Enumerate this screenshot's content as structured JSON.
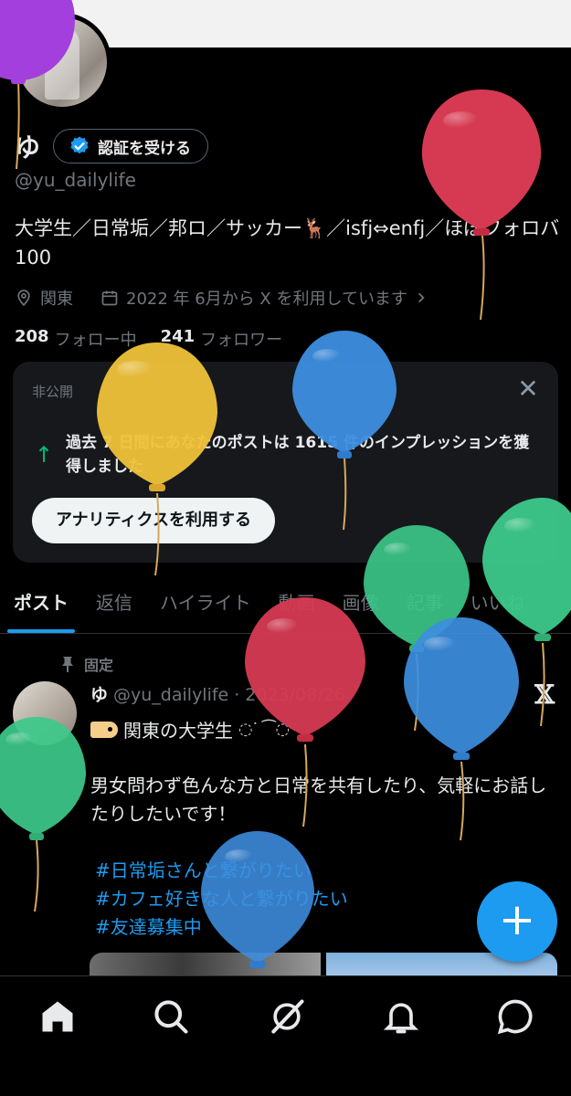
{
  "profile": {
    "name": "ゆ",
    "verify_label": "認証を受ける",
    "handle": "@yu_dailylife",
    "bio": "大学生／日常垢／邦ロ／サッカー🦌／isfj⇔enfj／ほぼフォロバ100",
    "location": "関東",
    "joined": "2022 年 6月から X を利用しています",
    "following_count": "208",
    "following_label": "フォロー中",
    "followers_count": "241",
    "followers_label": "フォロワー"
  },
  "analytics_card": {
    "private_label": "非公開",
    "message": "過去 7 日間にあなたのポストは 1615 件のインプレッションを獲得しました",
    "button_label": "アナリティクスを利用する"
  },
  "tabs": [
    "ポスト",
    "返信",
    "ハイライト",
    "動画",
    "画像",
    "記事",
    "いいね"
  ],
  "pinned_post": {
    "pinned_label": "固定",
    "author_name": "ゆ",
    "author_handle": "@yu_dailylife",
    "date": "2023/08/26",
    "line1": "関東の大学生",
    "body": "男女問わず色んな方と日常を共有したり、気軽にお話したりしたいです！",
    "hashtags": [
      "#日常垢さんと繋がりたい",
      "#カフェ好きな人と繋がりたい",
      "#友達募集中"
    ]
  },
  "fab_label": "+",
  "icons": {
    "verify": "verified-badge-icon",
    "location": "location-pin-icon",
    "calendar": "calendar-icon",
    "pin": "pin-icon",
    "x_logo": "x-logo-icon",
    "nav": [
      "home-icon",
      "search-icon",
      "grok-icon",
      "notifications-icon",
      "messages-icon"
    ]
  },
  "colors": {
    "accent": "#1d9bf0",
    "positive": "#00ba7c",
    "balloon_red": "#d63a52",
    "balloon_blue": "#3d8ee0",
    "balloon_green": "#3cc98a",
    "balloon_yellow": "#f0c23a",
    "balloon_purple": "#a33fdc"
  }
}
